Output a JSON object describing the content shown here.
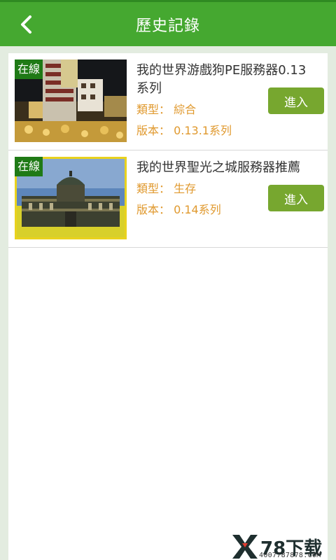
{
  "header": {
    "title": "歷史記錄",
    "back_icon": "chevron-left-icon"
  },
  "colors": {
    "header": "#45a830",
    "badge": "#1f7a16",
    "enter_button": "#77a72f",
    "meta_text": "#e0992e",
    "background": "#e3ece0"
  },
  "servers": [
    {
      "badge": "在線",
      "name": "我的世界游戲狗PE服務器0.13系列",
      "type": "類型： 綜合",
      "version": "版本： 0.13.1系列",
      "enter": "進入"
    },
    {
      "badge": "在線",
      "name": "我的世界聖光之城服務器推薦",
      "type": "類型： 生存",
      "version": "版本： 0.14系列",
      "enter": "進入"
    }
  ],
  "watermark": {
    "logo_text": "78下载",
    "url": "4007787878.COM"
  }
}
